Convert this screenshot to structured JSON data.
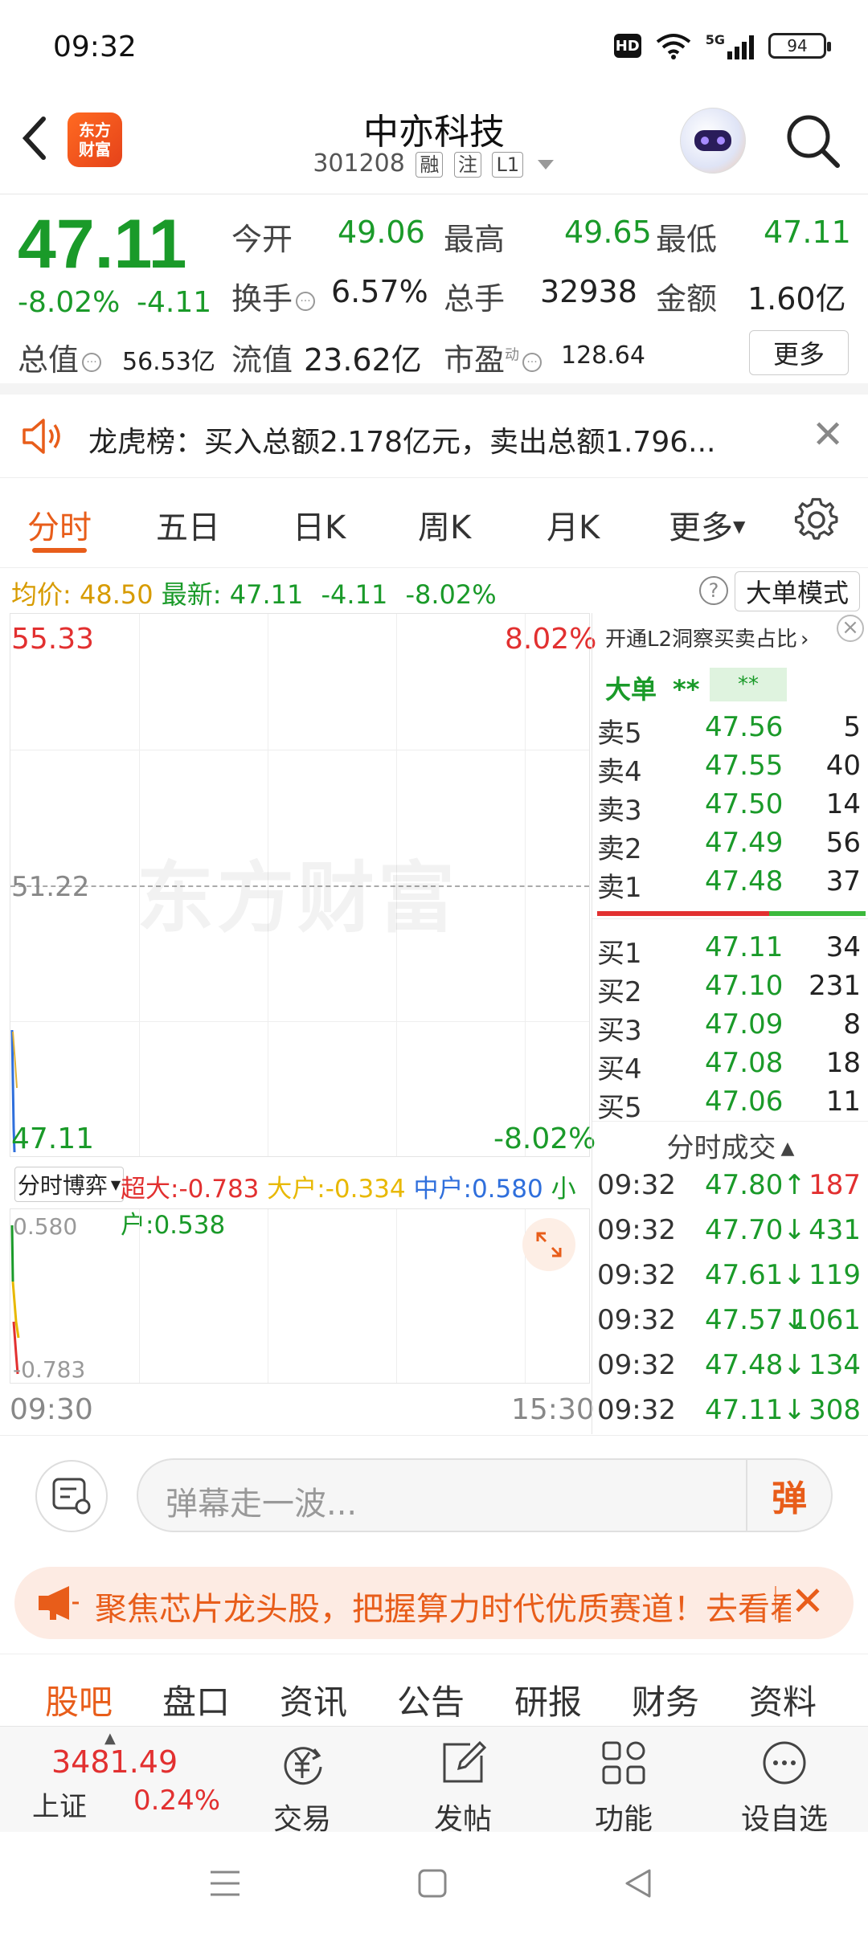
{
  "status_bar": {
    "time": "09:32",
    "battery": "94",
    "network": "5G",
    "hd": "HD"
  },
  "header": {
    "logo_line1": "东方",
    "logo_line2": "财富",
    "title": "中亦科技",
    "code": "301208",
    "tags": [
      "融",
      "注",
      "L1"
    ]
  },
  "quote": {
    "price": "47.11",
    "change_pct": "-8.02%",
    "change_abs": "-4.11",
    "open_label": "今开",
    "open": "49.06",
    "high_label": "最高",
    "high": "49.65",
    "low_label": "最低",
    "low": "47.11",
    "turnover_label": "换手",
    "turnover": "6.57%",
    "volume_label": "总手",
    "volume": "32938",
    "amount_label": "金额",
    "amount": "1.60亿",
    "mktcap_label": "总值",
    "mktcap": "56.53亿",
    "float_label": "流值",
    "float_cap": "23.62亿",
    "pe_label": "市盈",
    "pe_sup": "动",
    "pe": "128.64",
    "more_label": "更多"
  },
  "notice": {
    "text": "龙虎榜：买入总额2.178亿元，卖出总额1.796..."
  },
  "chart_tabs": [
    "分时",
    "五日",
    "日K",
    "周K",
    "月K",
    "更多"
  ],
  "avg_bar": {
    "avg_label": "均价:",
    "avg": "48.50",
    "latest_label": "最新:",
    "latest": "47.11",
    "latest_chg": "-4.11",
    "latest_pct": "-8.02%",
    "big_order_mode": "大单模式"
  },
  "chart": {
    "top_price": "55.33",
    "top_pct": "8.02%",
    "mid_price": "51.22",
    "bottom_price": "47.11",
    "bottom_pct": "-8.02%",
    "watermark": "东方财富",
    "time_start": "09:30",
    "time_end": "15:30"
  },
  "flow": {
    "select_label": "分时博弈",
    "super_label": "超大:",
    "super": "-0.783",
    "large_label": "大户:",
    "large": "-0.334",
    "mid_label": "中户:",
    "mid": "0.580",
    "small_label": "小户:",
    "small": "0.538",
    "sub_top": "0.580",
    "sub_bottom": "-0.783"
  },
  "orderbook": {
    "promo": "开通L2洞察买卖占比",
    "bigorder_label": "大单",
    "bigorder_mask": "**",
    "bigorder_box": "**",
    "asks": [
      {
        "label": "卖5",
        "price": "47.56",
        "vol": "5"
      },
      {
        "label": "卖4",
        "price": "47.55",
        "vol": "40"
      },
      {
        "label": "卖3",
        "price": "47.50",
        "vol": "14"
      },
      {
        "label": "卖2",
        "price": "47.49",
        "vol": "56"
      },
      {
        "label": "卖1",
        "price": "47.48",
        "vol": "37"
      }
    ],
    "bids": [
      {
        "label": "买1",
        "price": "47.11",
        "vol": "34"
      },
      {
        "label": "买2",
        "price": "47.10",
        "vol": "231"
      },
      {
        "label": "买3",
        "price": "47.09",
        "vol": "8"
      },
      {
        "label": "买4",
        "price": "47.08",
        "vol": "18"
      },
      {
        "label": "买5",
        "price": "47.06",
        "vol": "11"
      }
    ],
    "trades_title": "分时成交",
    "trades": [
      {
        "time": "09:32",
        "price": "47.80↑",
        "vol": "187",
        "dir": "up"
      },
      {
        "time": "09:32",
        "price": "47.70↓",
        "vol": "431",
        "dir": "down"
      },
      {
        "time": "09:32",
        "price": "47.61↓",
        "vol": "119",
        "dir": "down"
      },
      {
        "time": "09:32",
        "price": "47.57↓",
        "vol": "1061",
        "dir": "down"
      },
      {
        "time": "09:32",
        "price": "47.48↓",
        "vol": "134",
        "dir": "down"
      },
      {
        "time": "09:32",
        "price": "47.11↓",
        "vol": "308",
        "dir": "down"
      }
    ]
  },
  "danmaku": {
    "placeholder": "弹幕走一波...",
    "send": "弹"
  },
  "promo": {
    "text": "聚焦芯片龙头股，把握算力时代优质赛道！去看看"
  },
  "info_tabs": [
    "股吧",
    "盘口",
    "资讯",
    "公告",
    "研报",
    "财务",
    "资料"
  ],
  "bottom_nav": {
    "index_value": "3481.49",
    "index_name": "上证",
    "index_pct": "0.24%",
    "items": [
      "交易",
      "发帖",
      "功能",
      "设自选"
    ]
  },
  "colors": {
    "up": "#e23030",
    "down": "#1a9a29",
    "accent": "#e85d1a"
  }
}
